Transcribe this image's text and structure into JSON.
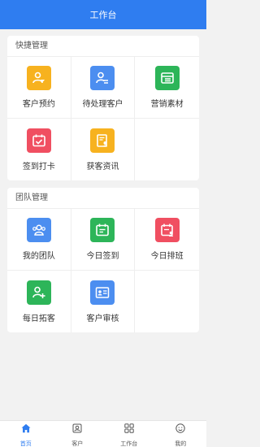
{
  "header": {
    "title": "工作台"
  },
  "colors": {
    "primary": "#2f7df0",
    "yellow": "#f7b21f",
    "blue": "#4c8ef0",
    "green": "#2db559",
    "red": "#f04f61"
  },
  "quick": {
    "title": "快捷管理",
    "items": [
      {
        "label": "客户预约",
        "icon": "customer-appointment-icon",
        "color": "#f7b21f"
      },
      {
        "label": "待处理客户",
        "icon": "pending-customer-icon",
        "color": "#4c8ef0"
      },
      {
        "label": "营销素材",
        "icon": "marketing-material-icon",
        "color": "#2db559"
      },
      {
        "label": "签到打卡",
        "icon": "check-in-icon",
        "color": "#f04f61"
      },
      {
        "label": "获客资讯",
        "icon": "leads-info-icon",
        "color": "#f7b21f"
      }
    ]
  },
  "team": {
    "title": "团队管理",
    "items": [
      {
        "label": "我的团队",
        "icon": "my-team-icon",
        "color": "#4c8ef0"
      },
      {
        "label": "今日签到",
        "icon": "today-check-in-icon",
        "color": "#2db559"
      },
      {
        "label": "今日排班",
        "icon": "today-schedule-icon",
        "color": "#f04f61"
      },
      {
        "label": "每日拓客",
        "icon": "daily-prospect-icon",
        "color": "#2db559"
      },
      {
        "label": "客户审核",
        "icon": "customer-review-icon",
        "color": "#4c8ef0"
      }
    ]
  },
  "tabbar": {
    "items": [
      {
        "label": "首页",
        "icon": "home-icon",
        "active": true
      },
      {
        "label": "客户",
        "icon": "customer-icon",
        "active": false
      },
      {
        "label": "工作台",
        "icon": "workbench-icon",
        "active": false
      },
      {
        "label": "我的",
        "icon": "profile-icon",
        "active": false
      }
    ]
  }
}
